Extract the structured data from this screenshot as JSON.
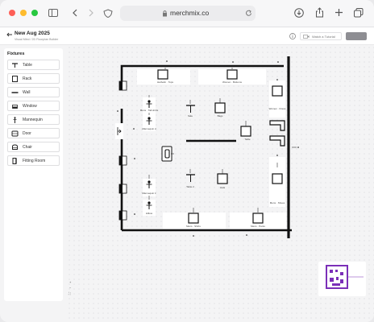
{
  "browser": {
    "url": "merchmix.co"
  },
  "app": {
    "title": "New Aug 2025",
    "breadcrumb": "Visual Mind / 2D Floorplan Builder",
    "watch_label": "Watch a Tutorial",
    "save_label": "Save"
  },
  "sidebar": {
    "title": "Fixtures",
    "items": [
      {
        "label": "Table",
        "icon": "table-icon"
      },
      {
        "label": "Rack",
        "icon": "rack-icon"
      },
      {
        "label": "Wall",
        "icon": "wall-icon"
      },
      {
        "label": "Window",
        "icon": "window-icon"
      },
      {
        "label": "Mannequin",
        "icon": "mannequin-icon"
      },
      {
        "label": "Door",
        "icon": "door-icon"
      },
      {
        "label": "Chair",
        "icon": "chair-icon"
      },
      {
        "label": "Fitting Room",
        "icon": "fitting-room-icon"
      }
    ]
  },
  "floorplan": {
    "labels": {
      "top_left_rack": "Harbelin · Tops",
      "top_right_rack": "Women · Bottoms",
      "right_top_rack": "Women · Dress",
      "mannequin_1": "Mens · Tall shirts",
      "table_1": "Sale",
      "rack_center_top": "Bags",
      "table_center": "Table",
      "mannequin_2": "Mannequin 2",
      "table_2": "Table 2",
      "rack_center_bottom": "Hats",
      "right_bottom_rack": "Mens · Shoes",
      "mannequin_3": "Mannequin 1",
      "mannequin_4": "Hillow",
      "bottom_left_rack": "Mens · Shirts",
      "bottom_right_rack": "Mens · Pants"
    }
  },
  "zoom": {
    "plus": "+",
    "minus": "−",
    "fit": "⛶"
  },
  "colors": {
    "accent": "#7b2fb8",
    "save_bg": "#8e8e93"
  }
}
